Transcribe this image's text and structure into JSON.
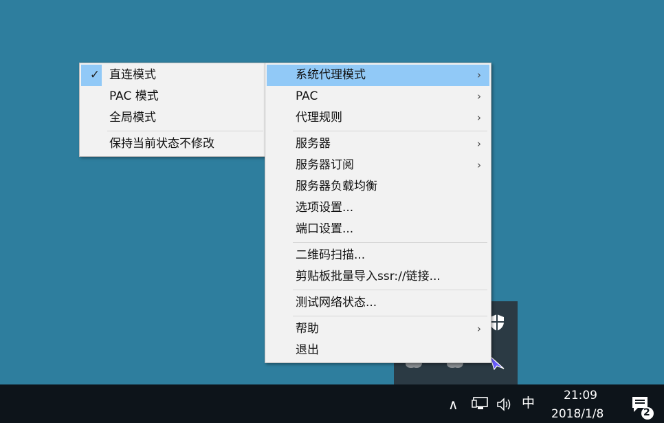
{
  "main_menu": {
    "items": [
      {
        "label": "系统代理模式",
        "arrow": "›",
        "highlighted": true
      },
      {
        "label": "PAC",
        "arrow": "›"
      },
      {
        "label": "代理规则",
        "arrow": "›"
      },
      {
        "separator": true
      },
      {
        "label": "服务器",
        "arrow": "›"
      },
      {
        "label": "服务器订阅",
        "arrow": "›"
      },
      {
        "label": "服务器负载均衡"
      },
      {
        "label": "选项设置..."
      },
      {
        "label": "端口设置..."
      },
      {
        "separator": true
      },
      {
        "label": "二维码扫描..."
      },
      {
        "label": "剪贴板批量导入ssr://链接..."
      },
      {
        "separator": true
      },
      {
        "label": "测试网络状态..."
      },
      {
        "separator": true
      },
      {
        "label": "帮助",
        "arrow": "›"
      },
      {
        "label": "退出"
      }
    ]
  },
  "sub_menu": {
    "items": [
      {
        "label": "直连模式",
        "check": "✓"
      },
      {
        "label": "PAC 模式"
      },
      {
        "label": "全局模式"
      },
      {
        "separator": true
      },
      {
        "label": "保持当前状态不修改"
      }
    ]
  },
  "taskbar": {
    "chevron": "∧",
    "ime": "中",
    "time": "21:09",
    "date": "2018/1/8",
    "notification_count": "2"
  },
  "icons": {
    "shield": "shield-icon",
    "network": "network-icon",
    "volume": "volume-icon",
    "notification": "notification-icon",
    "paper_plane": "paper-plane-icon"
  },
  "colors": {
    "desktop": "#2e7e9e",
    "highlight": "#91c9f7",
    "taskbar": "#0d141a"
  }
}
